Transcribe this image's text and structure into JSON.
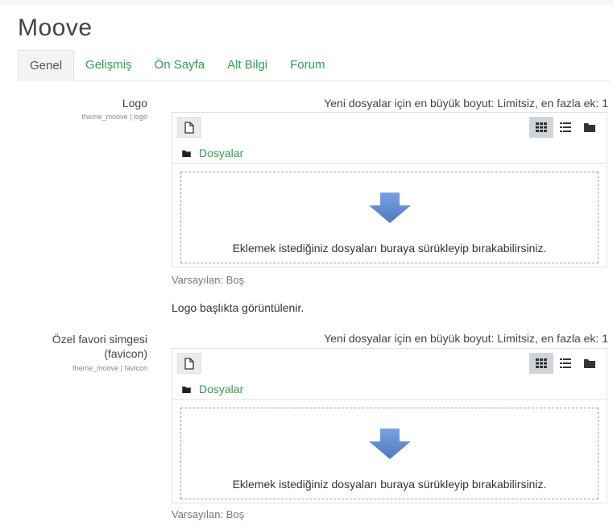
{
  "page": {
    "title": "Moove"
  },
  "tabs": [
    {
      "label": "Genel"
    },
    {
      "label": "Gelişmiş"
    },
    {
      "label": "Ön Sayfa"
    },
    {
      "label": "Alt Bilgi"
    },
    {
      "label": "Forum"
    }
  ],
  "active_tab": "Genel",
  "settings": [
    {
      "label": "Logo",
      "id": "theme_moove | logo",
      "max_info": "Yeni dosyalar için en büyük boyut: Limitsiz, en fazla ek: 1",
      "path_label": "Dosyalar",
      "drop_text": "Eklemek istediğiniz dosyaları buraya sürükleyip bırakabilirsiniz.",
      "default": "Varsayılan: Boş",
      "description": "Logo başlıkta görüntülenir."
    },
    {
      "label_line1": "Özel favori simgesi",
      "label_line2": "(favicon)",
      "id": "theme_moove | favicon",
      "max_info": "Yeni dosyalar için en büyük boyut: Limitsiz, en fazla ek: 1",
      "path_label": "Dosyalar",
      "drop_text": "Eklemek istediğiniz dosyaları buraya sürükleyip bırakabilirsiniz.",
      "default": "Varsayılan: Boş"
    }
  ],
  "icons": {
    "add_file": "file-icon",
    "view_icons": "grid-icon",
    "view_list": "list-icon",
    "view_tree": "folder-icon",
    "path": "folder-icon",
    "drop": "arrow-down-icon"
  },
  "colors": {
    "link": "#2e9e50",
    "arrow": "#5b86c9"
  }
}
